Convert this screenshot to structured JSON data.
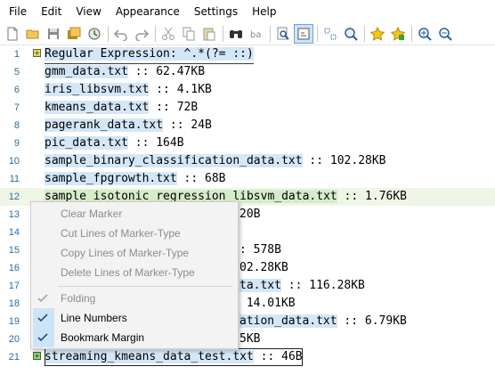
{
  "menu": [
    "File",
    "Edit",
    "View",
    "Appearance",
    "Settings",
    "Help"
  ],
  "toolbar": {
    "buttons": [
      "new-file-icon",
      "open-folder-icon",
      "save-icon",
      "save-all-icon",
      "reload-icon",
      "undo-icon",
      "redo-icon",
      "cut-icon",
      "copy-icon",
      "paste-icon",
      "find-icon",
      "replace-icon",
      "find-in-files-icon",
      "word-wrap-icon",
      "mark-icon",
      "zoom-icon",
      "bookmark-star-icon",
      "bookmark-add-icon",
      "zoom-in-icon",
      "zoom-out-icon"
    ]
  },
  "editor": {
    "lines": [
      {
        "n": "1",
        "file": "Regular Expression: ^.*(?= ::)",
        "size": "",
        "style": "header"
      },
      {
        "n": "5",
        "file": "gmm_data.txt",
        "size": " :: 62.47KB"
      },
      {
        "n": "6",
        "file": "iris_libsvm.txt",
        "size": " :: 4.1KB"
      },
      {
        "n": "7",
        "file": "kmeans_data.txt",
        "size": " :: 72B"
      },
      {
        "n": "8",
        "file": "pagerank_data.txt",
        "size": " :: 24B"
      },
      {
        "n": "9",
        "file": "pic_data.txt",
        "size": " :: 164B"
      },
      {
        "n": "10",
        "file": "sample_binary_classification_data.txt",
        "size": " :: 102.28KB"
      },
      {
        "n": "11",
        "file": "sample_fpgrowth.txt",
        "size": " :: 68B"
      },
      {
        "n": "12",
        "file": "sample_isotonic_regression_libsvm_data.txt",
        "size": " :: 1.76KB",
        "style": "green"
      },
      {
        "n": "13",
        "file": "",
        "size": "20B"
      },
      {
        "n": "14",
        "file": "",
        "size": ""
      },
      {
        "n": "15",
        "file": "",
        "size": ": 578B"
      },
      {
        "n": "16",
        "file": "",
        "size": "02.28KB"
      },
      {
        "n": "17",
        "file": "ta.txt",
        "size": " :: 116.28KB"
      },
      {
        "n": "18",
        "file": "",
        "size": " 14.01KB"
      },
      {
        "n": "19",
        "file": "ation_data.txt",
        "size": " :: 6.79KB"
      },
      {
        "n": "20",
        "file": "",
        "size": "5KB"
      },
      {
        "n": "21",
        "file": "streaming_kmeans_data_test.txt",
        "size": " :: 46B",
        "style": "boxed"
      }
    ]
  },
  "context_menu": {
    "items": [
      {
        "label": "Clear Marker",
        "disabled": true
      },
      {
        "label": "Cut Lines of Marker-Type",
        "disabled": true
      },
      {
        "label": "Copy Lines of Marker-Type",
        "disabled": true
      },
      {
        "label": "Delete Lines of Marker-Type",
        "disabled": true
      },
      {
        "label": "Folding",
        "disabled": true,
        "checked": true
      },
      {
        "label": "Line Numbers",
        "disabled": false,
        "checked": true
      },
      {
        "label": "Bookmark Margin",
        "disabled": false,
        "checked": true
      }
    ]
  },
  "colors": {
    "accent": "#cfe3f7",
    "line_number": "#2b6b9a",
    "match_highlight": "#d4e7f8",
    "current_line": "#eef6e6"
  }
}
